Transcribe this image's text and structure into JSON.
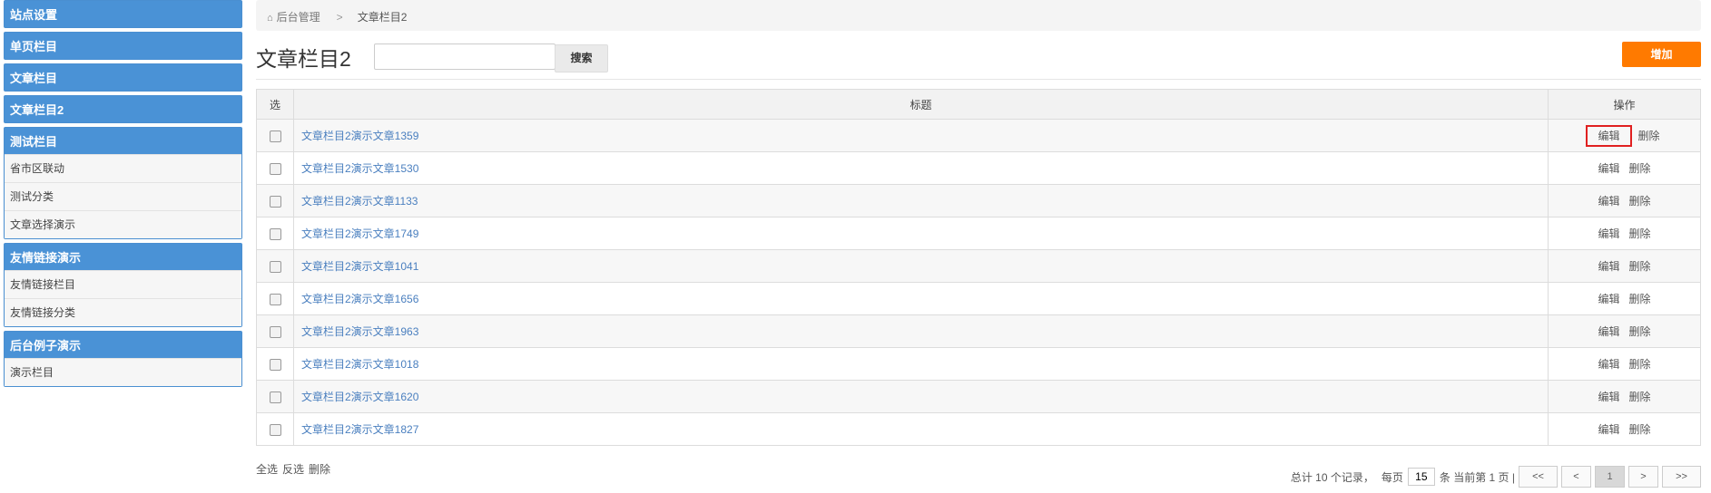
{
  "sidebar": {
    "groups": [
      {
        "title": "站点设置",
        "items": []
      },
      {
        "title": "单页栏目",
        "items": []
      },
      {
        "title": "文章栏目",
        "items": []
      },
      {
        "title": "文章栏目2",
        "items": []
      },
      {
        "title": "测试栏目",
        "items": [
          "省市区联动",
          "测试分类",
          "文章选择演示"
        ]
      },
      {
        "title": "友情链接演示",
        "items": [
          "友情链接栏目",
          "友情链接分类"
        ]
      },
      {
        "title": "后台例子演示",
        "items": [
          "演示栏目"
        ]
      }
    ]
  },
  "breadcrumb": {
    "home": "后台管理",
    "separator": ">",
    "current": "文章栏目2"
  },
  "header": {
    "title": "文章栏目2",
    "search_value": "",
    "search_btn": "搜索",
    "add_btn": "增加"
  },
  "table": {
    "headers": [
      "选",
      "标题",
      "操作"
    ],
    "rows": [
      {
        "title": "文章栏目2演示文章1359"
      },
      {
        "title": "文章栏目2演示文章1530"
      },
      {
        "title": "文章栏目2演示文章1133"
      },
      {
        "title": "文章栏目2演示文章1749"
      },
      {
        "title": "文章栏目2演示文章1041"
      },
      {
        "title": "文章栏目2演示文章1656"
      },
      {
        "title": "文章栏目2演示文章1963"
      },
      {
        "title": "文章栏目2演示文章1018"
      },
      {
        "title": "文章栏目2演示文章1620"
      },
      {
        "title": "文章栏目2演示文章1827"
      }
    ],
    "edit_label": "编辑",
    "delete_label": "删除"
  },
  "bulk": {
    "select_all": "全选",
    "invert": "反选",
    "delete": "删除"
  },
  "pager": {
    "total_text": "总计 10 个记录，",
    "per_page_label": "每页",
    "per_page_value": "15",
    "status_text": "条 当前第 1 页 |",
    "first": "<<",
    "prev": "<",
    "current": "1",
    "next": ">",
    "last": ">>"
  },
  "colors": {
    "sidebar_head": "#4a92d6",
    "add_button": "#ff7a00",
    "link": "#4a7fbf",
    "highlight": "#e02020"
  }
}
